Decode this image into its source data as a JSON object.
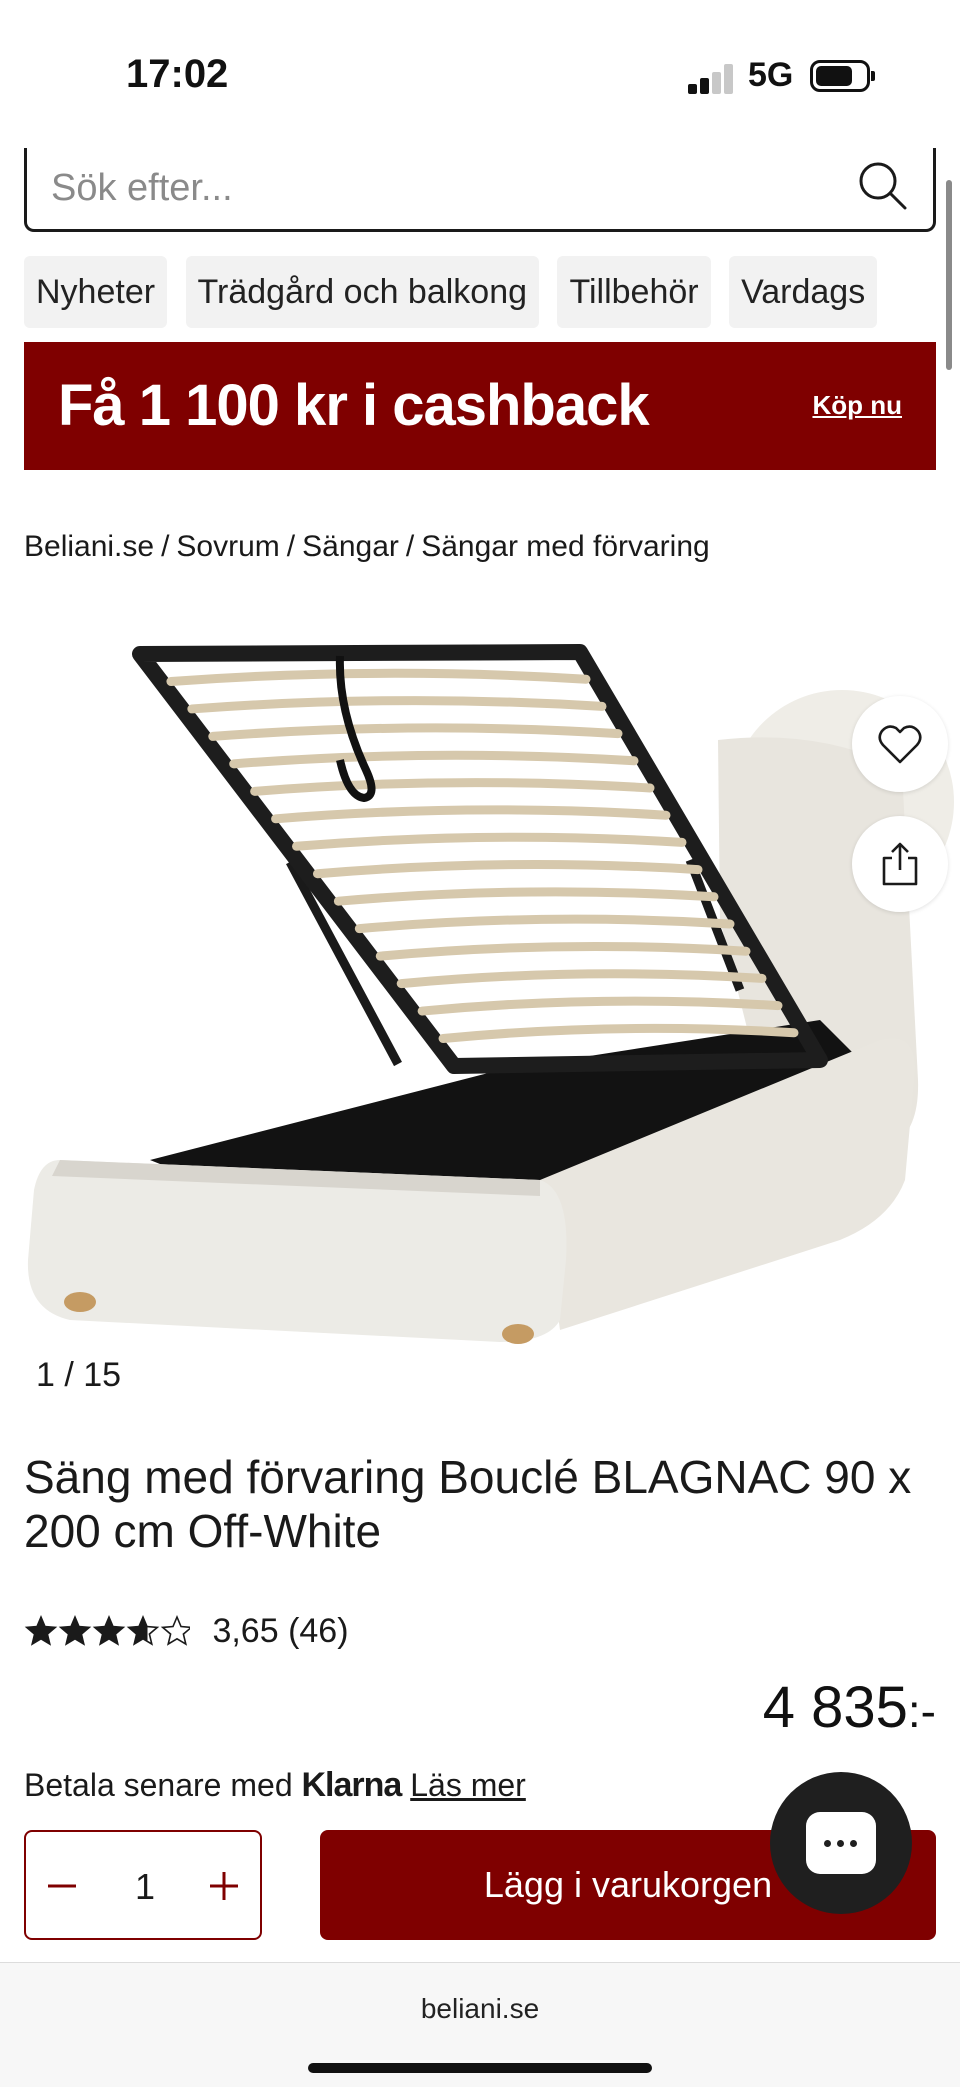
{
  "status_bar": {
    "time": "17:02",
    "network": "5G",
    "battery_fraction": 0.75
  },
  "search": {
    "placeholder": "Sök efter..."
  },
  "categories": [
    "Nyheter",
    "Trädgård och balkong",
    "Tillbehör",
    "Vardags"
  ],
  "banner": {
    "text": "Få 1 100 kr i cashback",
    "link": "Köp nu"
  },
  "breadcrumb": [
    "Beliani.se",
    "Sovrum",
    "Sängar",
    "Sängar med förvaring"
  ],
  "gallery": {
    "current": "1",
    "total": "15"
  },
  "product": {
    "title": "Säng med förvaring Bouclé BLAGNAC 90 x 200 cm Off-White",
    "rating_value": 3.65,
    "rating_text": "3,65 (46)",
    "price": "4 835",
    "price_suffix": ":-"
  },
  "klarna": {
    "prefix": "Betala senare med",
    "brand": "Klarna",
    "link": "Läs mer"
  },
  "cart": {
    "quantity": "1",
    "add_label": "Lägg i varukorgen"
  },
  "browser": {
    "url": "beliani.se"
  },
  "colors": {
    "brand": "#7f0000",
    "text": "#1a1a1a",
    "chip_bg": "#f2f2f2"
  },
  "icons": [
    "search-icon",
    "heart-icon",
    "share-icon",
    "minus-icon",
    "plus-icon",
    "chat-icon",
    "star-icon"
  ]
}
